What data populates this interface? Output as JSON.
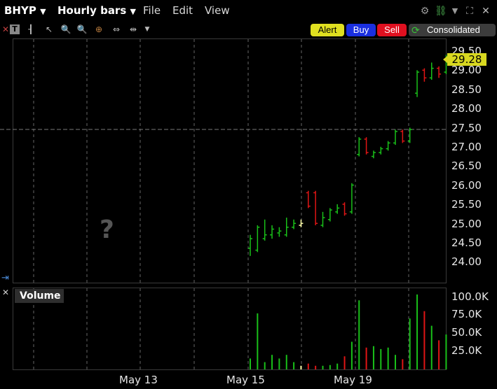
{
  "header": {
    "symbol": "BHYP",
    "period": "Hourly bars",
    "menus": [
      "File",
      "Edit",
      "View"
    ]
  },
  "toolbar": {
    "alert_label": "Alert",
    "buy_label": "Buy",
    "sell_label": "Sell",
    "consolidated_label": "Consolidated",
    "colors": {
      "alert": "#e0e020",
      "buy": "#1a2fe0",
      "sell": "#e01020",
      "consolidated": "#3c3c3c"
    }
  },
  "price_axis": {
    "ticks": [
      "29.50",
      "29.00",
      "28.50",
      "28.00",
      "27.50",
      "27.00",
      "26.50",
      "26.00",
      "25.50",
      "25.00",
      "24.50",
      "24.00"
    ],
    "last_price": "29.28"
  },
  "volume_pane": {
    "title": "Volume",
    "ticks": [
      "100.0K",
      "75.0K",
      "50.0K",
      "25.0K"
    ]
  },
  "dates": [
    "May 13",
    "May 15",
    "May 19"
  ],
  "placeholder": "?",
  "chart_data": {
    "type": "ohlc",
    "ylim": [
      23.6,
      29.75
    ],
    "volume_ylim": [
      0,
      110000
    ],
    "up_color": "#19c019",
    "down_color": "#e01515",
    "bars": [
      {
        "o": 24.35,
        "h": 24.7,
        "l": 24.15,
        "c": 24.6,
        "v": 15000
      },
      {
        "o": 24.3,
        "h": 24.95,
        "l": 24.25,
        "c": 24.9,
        "v": 77000
      },
      {
        "o": 24.6,
        "h": 25.1,
        "l": 24.55,
        "c": 24.7,
        "v": 10000
      },
      {
        "o": 24.7,
        "h": 24.95,
        "l": 24.6,
        "c": 24.85,
        "v": 20000
      },
      {
        "o": 24.75,
        "h": 24.9,
        "l": 24.65,
        "c": 24.8,
        "v": 15000
      },
      {
        "o": 24.7,
        "h": 25.15,
        "l": 24.65,
        "c": 24.9,
        "v": 20000
      },
      {
        "o": 24.9,
        "h": 25.1,
        "l": 24.85,
        "c": 25.0,
        "v": 10000
      },
      {
        "o": 24.95,
        "h": 25.1,
        "l": 24.9,
        "c": 25.0,
        "v": 5000,
        "neutral": true
      },
      {
        "o": 25.8,
        "h": 25.85,
        "l": 25.4,
        "c": 25.45,
        "v": 8000
      },
      {
        "o": 25.8,
        "h": 25.85,
        "l": 24.95,
        "c": 25.0,
        "v": 5000
      },
      {
        "o": 24.95,
        "h": 25.3,
        "l": 24.9,
        "c": 25.15,
        "v": 5000
      },
      {
        "o": 25.1,
        "h": 25.4,
        "l": 25.05,
        "c": 25.35,
        "v": 6000
      },
      {
        "o": 25.3,
        "h": 25.5,
        "l": 25.25,
        "c": 25.4,
        "v": 8000
      },
      {
        "o": 25.5,
        "h": 25.55,
        "l": 25.2,
        "c": 25.25,
        "v": 18000
      },
      {
        "o": 25.3,
        "h": 26.05,
        "l": 25.25,
        "c": 26.0,
        "v": 38000
      },
      {
        "o": 26.8,
        "h": 27.25,
        "l": 26.75,
        "c": 27.2,
        "v": 95000
      },
      {
        "o": 27.2,
        "h": 27.25,
        "l": 26.8,
        "c": 26.85,
        "v": 30000
      },
      {
        "o": 26.75,
        "h": 26.9,
        "l": 26.7,
        "c": 26.85,
        "v": 32000
      },
      {
        "o": 26.85,
        "h": 27.0,
        "l": 26.8,
        "c": 26.95,
        "v": 28000
      },
      {
        "o": 26.95,
        "h": 27.15,
        "l": 26.9,
        "c": 27.1,
        "v": 30000
      },
      {
        "o": 27.1,
        "h": 27.45,
        "l": 27.05,
        "c": 27.4,
        "v": 20000
      },
      {
        "o": 27.4,
        "h": 27.45,
        "l": 27.1,
        "c": 27.15,
        "v": 14000
      },
      {
        "o": 27.15,
        "h": 27.5,
        "l": 27.1,
        "c": 27.45,
        "v": 70000
      },
      {
        "o": 28.4,
        "h": 29.0,
        "l": 28.3,
        "c": 28.95,
        "v": 103000
      },
      {
        "o": 29.0,
        "h": 29.05,
        "l": 28.7,
        "c": 28.8,
        "v": 80000
      },
      {
        "o": 28.8,
        "h": 29.2,
        "l": 28.75,
        "c": 29.05,
        "v": 60000
      },
      {
        "o": 29.05,
        "h": 29.1,
        "l": 28.8,
        "c": 28.9,
        "v": 40000
      },
      {
        "o": 28.95,
        "h": 29.4,
        "l": 28.9,
        "c": 29.28,
        "v": 48000
      }
    ]
  }
}
